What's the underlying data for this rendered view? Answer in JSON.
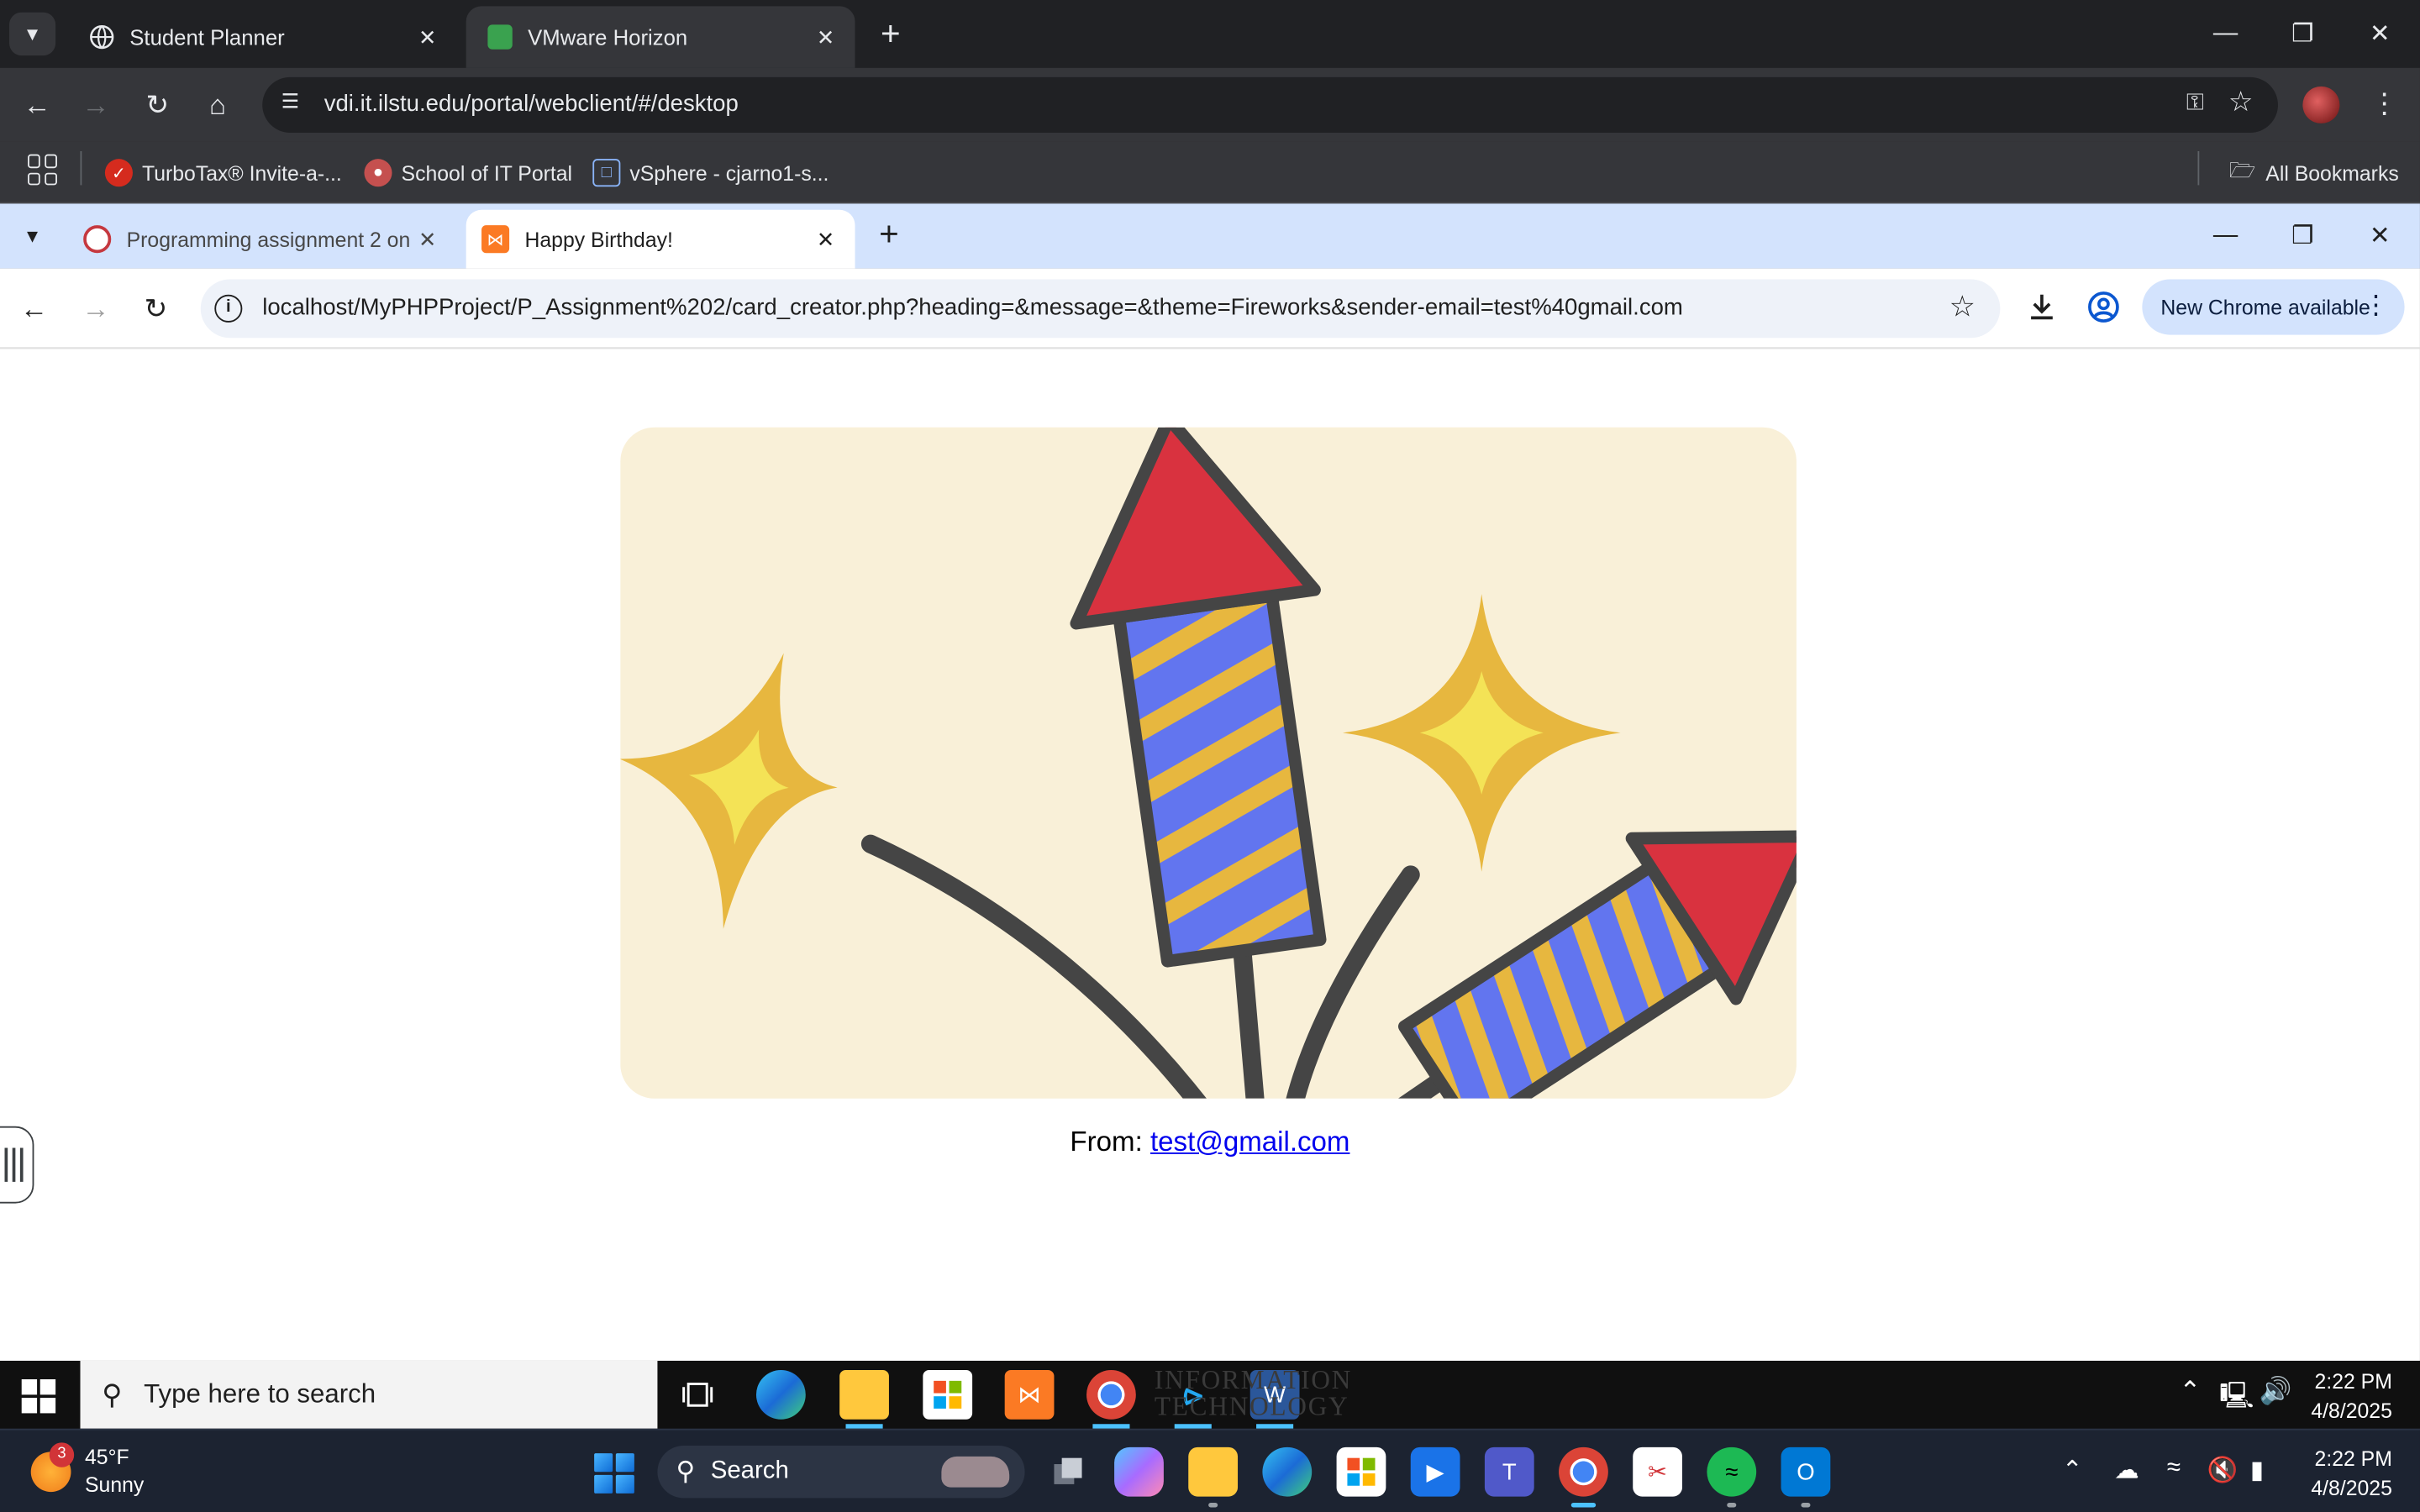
{
  "outer_browser": {
    "tabs": [
      {
        "title": "Student Planner",
        "active": false
      },
      {
        "title": "VMware Horizon",
        "active": true
      }
    ],
    "url": "vdi.it.ilstu.edu/portal/webclient/#/desktop",
    "bookmarks": [
      {
        "label": "TurboTax® Invite-a-..."
      },
      {
        "label": "School of IT Portal"
      },
      {
        "label": "vSphere - cjarno1-s..."
      }
    ],
    "all_bookmarks_label": "All Bookmarks"
  },
  "inner_browser": {
    "tabs": [
      {
        "title": "Programming assignment 2 on",
        "active": false
      },
      {
        "title": "Happy Birthday!",
        "active": true
      }
    ],
    "url": "localhost/MyPHPProject/P_Assignment%202/card_creator.php?heading=&message=&theme=Fireworks&sender-email=test%40gmail.com",
    "update_chip": "New Chrome available"
  },
  "card": {
    "theme_colors": {
      "background": "#f9f0d8",
      "rocket_body": "#6275ef",
      "rocket_stripes": "#e7b73f",
      "rocket_tip": "#d9323f",
      "outline": "#454545",
      "sparkle_outer": "#e7b73f",
      "sparkle_inner": "#f4e356"
    },
    "from_label": "From:",
    "sender_email": "test@gmail.com"
  },
  "vdi_taskbar": {
    "search_placeholder": "Type here to search",
    "watermark_line1": "INFORMATION",
    "watermark_line2": "TECHNOLOGY",
    "time": "2:22 PM",
    "date": "4/8/2025"
  },
  "host_taskbar": {
    "weather_badge": "3",
    "weather_temp": "45°F",
    "weather_condition": "Sunny",
    "search_label": "Search",
    "time": "2:22 PM",
    "date": "4/8/2025"
  }
}
